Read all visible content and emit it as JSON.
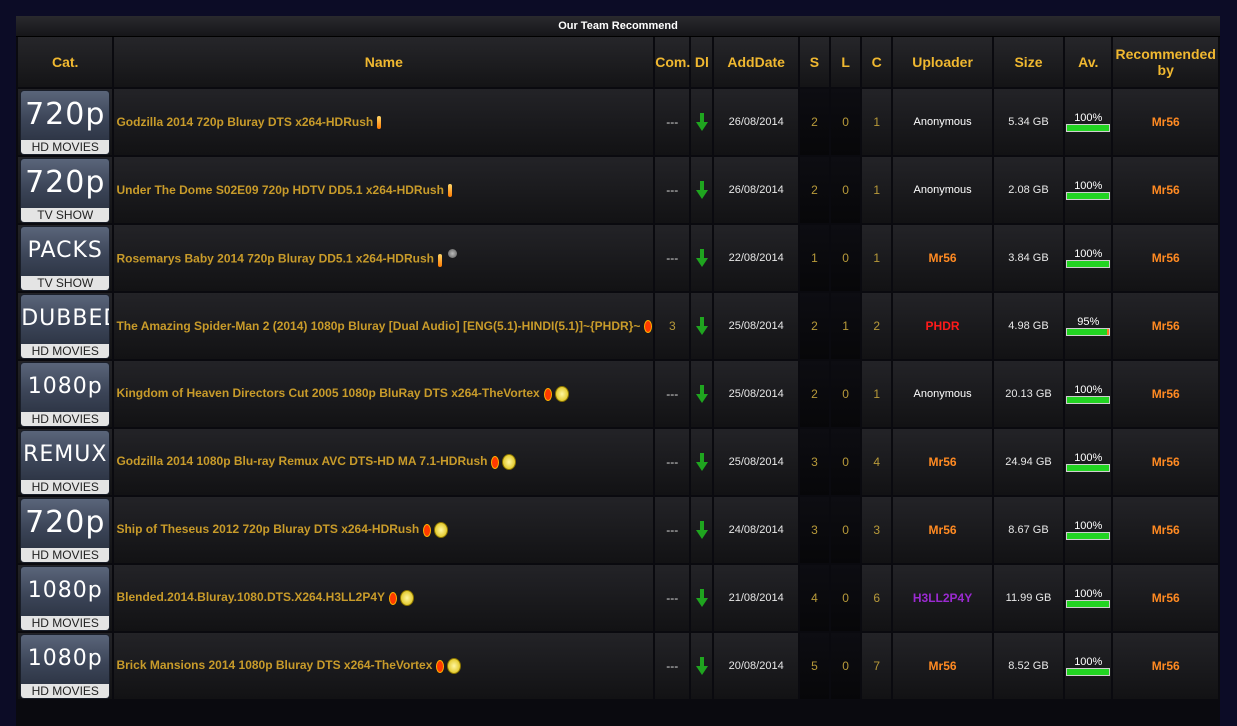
{
  "title": "Our Team Recommend",
  "headers": {
    "cat": "Cat.",
    "name": "Name",
    "com": "Com.",
    "dl": "Dl",
    "adddate": "AddDate",
    "s": "S",
    "l": "L",
    "c": "C",
    "uploader": "Uploader",
    "size": "Size",
    "av": "Av.",
    "rec1": "Recommended",
    "rec2": "by"
  },
  "rows": [
    {
      "cat_big": "720p",
      "cat_sub": "HD MOVIES",
      "name": "Godzilla 2014 720p Bluray DTS x264-HDRush",
      "icons": [
        "flame-icon"
      ],
      "com": "---",
      "date": "26/08/2014",
      "s": "2",
      "l": "0",
      "c": "1",
      "uploader": "Anonymous",
      "uploader_style": "anon",
      "size": "5.34 GB",
      "av_label": "100%",
      "av": 1.0,
      "rec": "Mr56"
    },
    {
      "cat_big": "720p",
      "cat_sub": "TV SHOW",
      "name": "Under The Dome S02E09 720p HDTV DD5.1 x264-HDRush",
      "icons": [
        "flame-icon"
      ],
      "com": "---",
      "date": "26/08/2014",
      "s": "2",
      "l": "0",
      "c": "1",
      "uploader": "Anonymous",
      "uploader_style": "anon",
      "size": "2.08 GB",
      "av_label": "100%",
      "av": 1.0,
      "rec": "Mr56"
    },
    {
      "cat_big": "PACKS",
      "cat_sub": "TV SHOW",
      "name": "Rosemarys Baby 2014 720p Bluray DD5.1 x264-HDRush",
      "icons": [
        "flame-icon",
        "moon-icon"
      ],
      "com": "---",
      "date": "22/08/2014",
      "s": "1",
      "l": "0",
      "c": "1",
      "uploader": "Mr56",
      "uploader_style": "orange",
      "size": "3.84 GB",
      "av_label": "100%",
      "av": 1.0,
      "rec": "Mr56"
    },
    {
      "cat_big": "DUBBED",
      "cat_sub": "HD MOVIES",
      "name": "The Amazing Spider-Man 2 (2014) 1080p Bluray [Dual Audio] [ENG(5.1)-HINDI(5.1)]~{PHDR}~",
      "icons": [
        "ruby-icon"
      ],
      "com": "3",
      "date": "25/08/2014",
      "s": "2",
      "l": "1",
      "c": "2",
      "uploader": "PHDR",
      "uploader_style": "red",
      "size": "4.98 GB",
      "av_label": "95%",
      "av": 0.95,
      "rec": "Mr56"
    },
    {
      "cat_big": "1080p",
      "cat_sub": "HD MOVIES",
      "name": "Kingdom of Heaven Directors Cut 2005 1080p BluRay DTS x264-TheVortex",
      "icons": [
        "ruby-icon",
        "coin-icon"
      ],
      "com": "---",
      "date": "25/08/2014",
      "s": "2",
      "l": "0",
      "c": "1",
      "uploader": "Anonymous",
      "uploader_style": "anon",
      "size": "20.13 GB",
      "av_label": "100%",
      "av": 1.0,
      "rec": "Mr56"
    },
    {
      "cat_big": "REMUX",
      "cat_sub": "HD MOVIES",
      "name": "Godzilla 2014 1080p Blu-ray Remux AVC DTS-HD MA 7.1-HDRush",
      "icons": [
        "ruby-icon",
        "coin-icon"
      ],
      "com": "---",
      "date": "25/08/2014",
      "s": "3",
      "l": "0",
      "c": "4",
      "uploader": "Mr56",
      "uploader_style": "orange",
      "size": "24.94 GB",
      "av_label": "100%",
      "av": 1.0,
      "rec": "Mr56"
    },
    {
      "cat_big": "720p",
      "cat_sub": "HD MOVIES",
      "name": "Ship of Theseus 2012 720p Bluray DTS x264-HDRush",
      "icons": [
        "ruby-icon",
        "coin-icon"
      ],
      "com": "---",
      "date": "24/08/2014",
      "s": "3",
      "l": "0",
      "c": "3",
      "uploader": "Mr56",
      "uploader_style": "orange",
      "size": "8.67 GB",
      "av_label": "100%",
      "av": 1.0,
      "rec": "Mr56"
    },
    {
      "cat_big": "1080p",
      "cat_sub": "HD MOVIES",
      "name": "Blended.2014.Bluray.1080.DTS.X264.H3LL2P4Y",
      "icons": [
        "ruby-icon",
        "coin-icon"
      ],
      "com": "---",
      "date": "21/08/2014",
      "s": "4",
      "l": "0",
      "c": "6",
      "uploader": "H3LL2P4Y",
      "uploader_style": "purple",
      "size": "11.99 GB",
      "av_label": "100%",
      "av": 1.0,
      "rec": "Mr56"
    },
    {
      "cat_big": "1080p",
      "cat_sub": "HD MOVIES",
      "name": "Brick Mansions 2014 1080p Bluray DTS x264-TheVortex",
      "icons": [
        "ruby-icon",
        "coin-icon"
      ],
      "com": "---",
      "date": "20/08/2014",
      "s": "5",
      "l": "0",
      "c": "7",
      "uploader": "Mr56",
      "uploader_style": "orange",
      "size": "8.52 GB",
      "av_label": "100%",
      "av": 1.0,
      "rec": "Mr56"
    }
  ]
}
